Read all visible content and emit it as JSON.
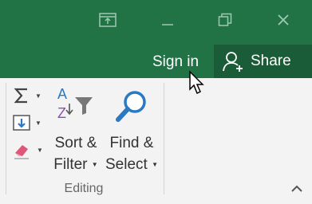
{
  "title_bar": {
    "buttons": [
      {
        "icon": "ribbon-display-options-icon"
      },
      {
        "icon": "minimize-icon"
      },
      {
        "icon": "restore-down-icon"
      },
      {
        "icon": "close-icon"
      }
    ]
  },
  "account": {
    "signin_label": "Sign in",
    "share_label": "Share",
    "share_icon": "person-add-icon"
  },
  "ribbon": {
    "group": {
      "label": "Editing",
      "small_buttons": [
        {
          "icon": "autosum-sigma-icon"
        },
        {
          "icon": "fill-down-icon"
        },
        {
          "icon": "eraser-icon"
        }
      ],
      "sort_filter": {
        "line1": "Sort &",
        "line2": "Filter",
        "icon": "sort-az-filter-icon"
      },
      "find_select": {
        "line1": "Find &",
        "line2": "Select",
        "icon": "magnifier-icon"
      }
    },
    "collapse_icon": "chevron-up-icon"
  },
  "colors": {
    "excel_green": "#217346",
    "share_green": "#1a5c37",
    "ribbon_bg": "#f3f3f3",
    "icon_blue": "#2b79c2",
    "icon_purple": "#8e4fb5",
    "eraser_pink": "#e0557a"
  }
}
